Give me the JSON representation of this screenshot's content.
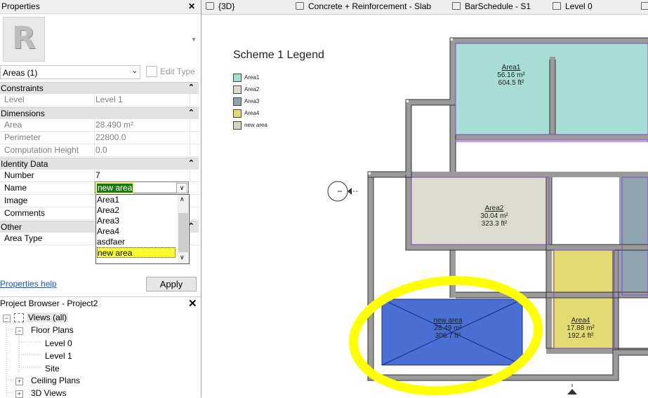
{
  "properties": {
    "title": "Properties",
    "type_selector": "Areas (1)",
    "edit_type": "Edit Type",
    "sections": {
      "constraints": "Constraints",
      "dimensions": "Dimensions",
      "identity": "Identity Data",
      "other": "Other"
    },
    "rows": {
      "level_k": "Level",
      "level_v": "Level 1",
      "area_k": "Area",
      "area_v": "28.490 m²",
      "perimeter_k": "Perimeter",
      "perimeter_v": "22800.0",
      "comp_k": "Computation Height",
      "comp_v": "0.0",
      "number_k": "Number",
      "number_v": "7",
      "name_k": "Name",
      "name_v": "new area",
      "image_k": "Image",
      "comments_k": "Comments",
      "areatype_k": "Area Type"
    },
    "dropdown_options": [
      "Area1",
      "Area2",
      "Area3",
      "Area4",
      "asdfaer",
      "new area"
    ],
    "help_link": "Properties help",
    "apply": "Apply"
  },
  "project_browser": {
    "title": "Project Browser - Project2",
    "views_all": "Views (all)",
    "floor_plans": "Floor Plans",
    "level0": "Level 0",
    "level1": "Level 1",
    "site": "Site",
    "ceiling_plans": "Ceiling Plans",
    "views3d": "3D Views"
  },
  "tabs": [
    "{3D}",
    "Concrete + Reinforcement - Slab",
    "BarSchedule - S1",
    "Level 0"
  ],
  "legend": {
    "title": "Scheme 1 Legend",
    "items": [
      {
        "label": "Area1",
        "color": "#a8ddd5"
      },
      {
        "label": "Area2",
        "color": "#dcdccc"
      },
      {
        "label": "Area3",
        "color": "#8fa4b0"
      },
      {
        "label": "Area4",
        "color": "#e4da72"
      },
      {
        "label": "new area",
        "color": "#d8d2c0"
      }
    ]
  },
  "areas": {
    "a1": {
      "name": "Area1",
      "m2": "56.16 m²",
      "ft2": "604.5 ft²"
    },
    "a2": {
      "name": "Area2",
      "m2": "30.04 m²",
      "ft2": "323.3 ft²"
    },
    "a4": {
      "name": "Area4",
      "m2": "17.88 m²",
      "ft2": "192.4 ft²"
    },
    "na": {
      "name": "new area",
      "m2": "28.49 m²",
      "ft2": "306.7 ft²"
    }
  },
  "colors": {
    "area1": "#a8ddd5",
    "area2": "#dcdccc",
    "area3": "#8fa4b0",
    "area4": "#e4da72",
    "new_area": "#4a6fd4",
    "highlight": "#ffff00"
  }
}
